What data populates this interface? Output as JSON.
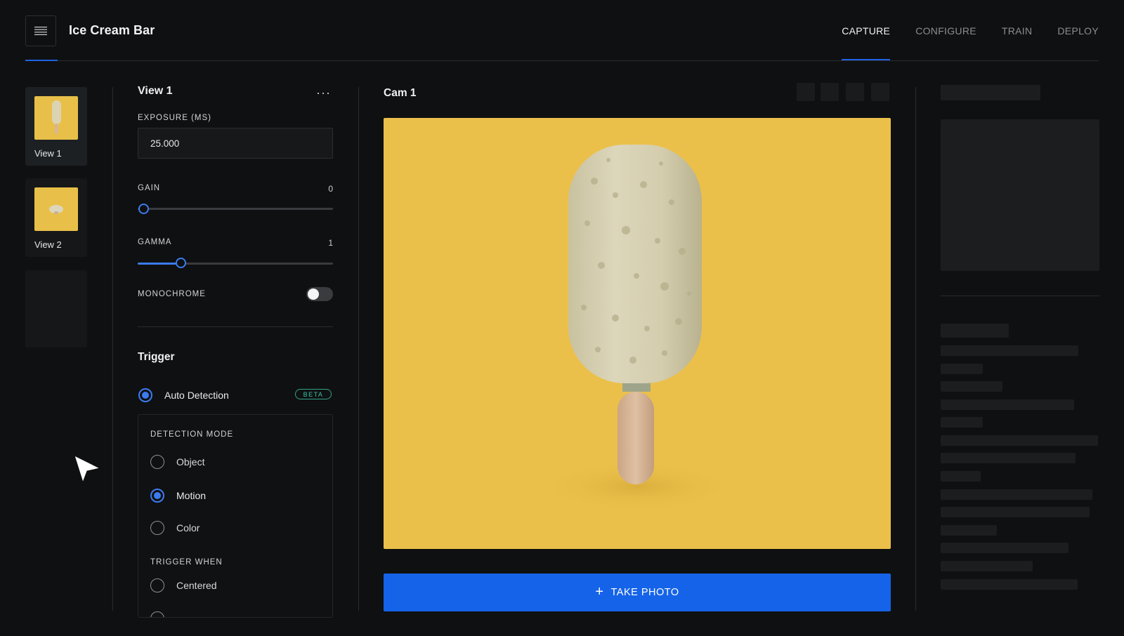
{
  "app": {
    "title": "Ice Cream Bar"
  },
  "nav": {
    "tabs": [
      {
        "label": "CAPTURE",
        "active": true
      },
      {
        "label": "CONFIGURE",
        "active": false
      },
      {
        "label": "TRAIN",
        "active": false
      },
      {
        "label": "DEPLOY",
        "active": false
      }
    ]
  },
  "views": [
    {
      "label": "View 1",
      "selected": true
    },
    {
      "label": "View 2",
      "selected": false
    }
  ],
  "settings": {
    "title": "View 1",
    "more_label": "···",
    "exposure": {
      "label": "EXPOSURE (MS)",
      "value": "25.000"
    },
    "gain": {
      "label": "GAIN",
      "value": "0",
      "level": 0
    },
    "gamma": {
      "label": "GAMMA",
      "value": "1",
      "level": 0.22
    },
    "monochrome": {
      "label": "MONOCHROME",
      "on": false
    }
  },
  "trigger": {
    "title": "Trigger",
    "auto_detection": {
      "label": "Auto Detection",
      "selected": true,
      "badge": "BETA"
    },
    "detection_mode": {
      "label": "DETECTION MODE",
      "options": [
        {
          "label": "Object",
          "selected": false
        },
        {
          "label": "Motion",
          "selected": true
        },
        {
          "label": "Color",
          "selected": false
        }
      ]
    },
    "trigger_when": {
      "label": "TRIGGER WHEN",
      "options": [
        {
          "label": "Centered",
          "selected": false
        }
      ]
    }
  },
  "camera": {
    "title": "Cam 1",
    "take_photo_label": "TAKE PHOTO",
    "background_color": "#ebc04a",
    "accent_color": "#1563e8"
  },
  "icons": {
    "menu": "hamburger-menu-icon",
    "more": "more-horizontal-icon",
    "plus": "plus-icon",
    "cursor": "mouse-pointer-icon"
  }
}
